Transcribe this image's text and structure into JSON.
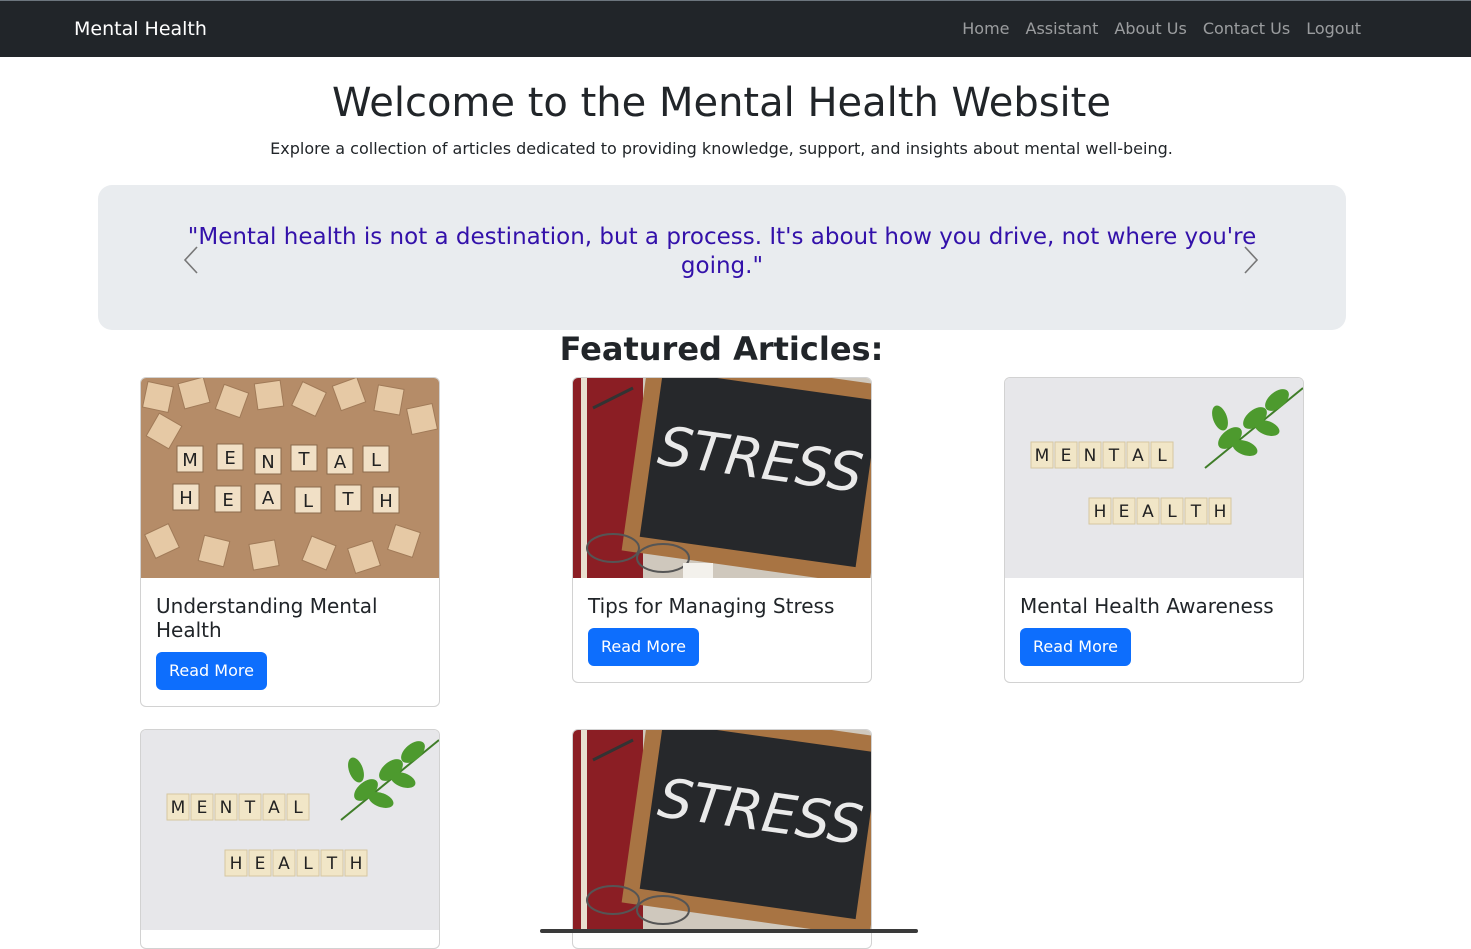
{
  "navbar": {
    "brand": "Mental Health",
    "links": [
      "Home",
      "Assistant",
      "About Us",
      "Contact Us",
      "Logout"
    ]
  },
  "hero": {
    "title": "Welcome to the Mental Health Website",
    "subtitle": "Explore a collection of articles dedicated to providing knowledge, support, and insights about mental well-being."
  },
  "carousel": {
    "quote": "\"Mental health is not a destination, but a process. It's about how you drive, not where you're going.\"",
    "prev_icon": "chevron-left-icon",
    "next_icon": "chevron-right-icon"
  },
  "featured": {
    "heading": "Featured Articles:",
    "articles": [
      {
        "title": "Understanding Mental Health",
        "button": "Read More",
        "image": "scrabble-tiles-mental-health"
      },
      {
        "title": "Tips for Managing Stress",
        "button": "Read More",
        "image": "chalkboard-stress"
      },
      {
        "title": "Mental Health Awareness",
        "button": "Read More",
        "image": "tiles-with-leaf"
      },
      {
        "title": "",
        "button": "",
        "image": "tiles-with-leaf"
      },
      {
        "title": "",
        "button": "",
        "image": "chalkboard-stress"
      }
    ]
  },
  "colors": {
    "navbar_bg": "#212529",
    "primary": "#0d6efd",
    "quote_text": "#3311aa",
    "carousel_bg": "#e9ecef"
  }
}
